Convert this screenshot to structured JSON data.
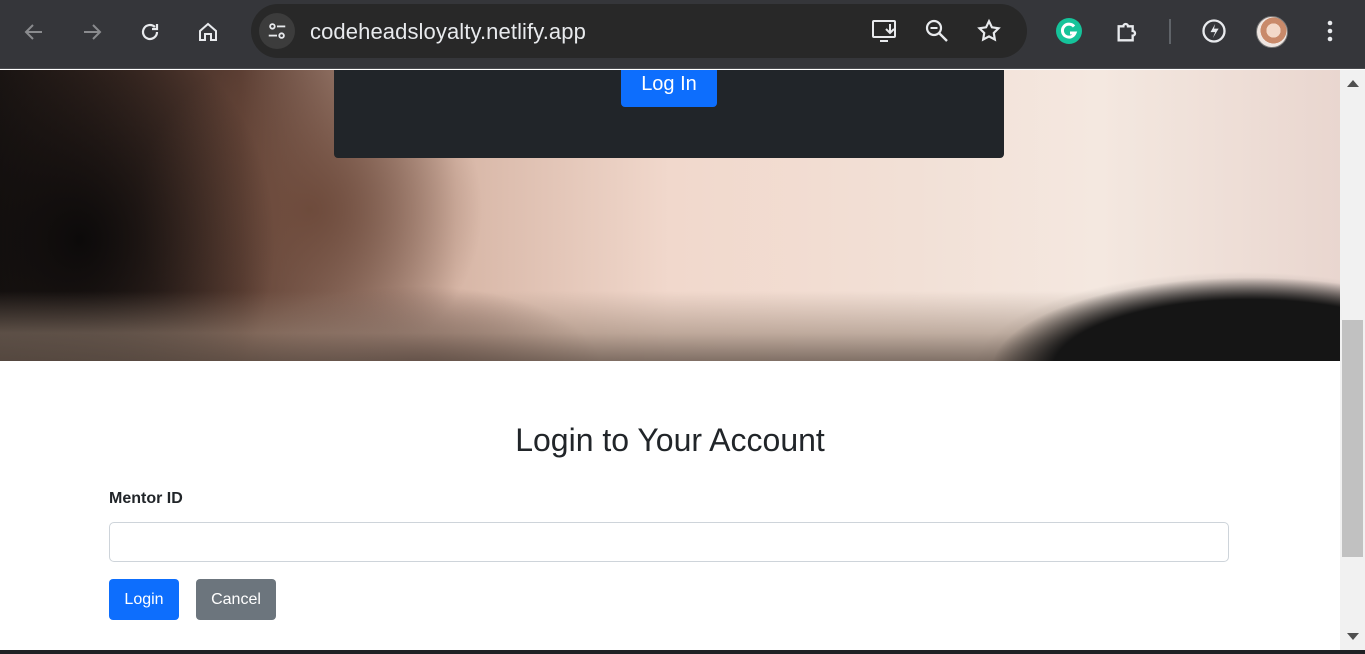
{
  "browser": {
    "url": "codeheadsloyalty.netlify.app"
  },
  "hero": {
    "card_login_label": "Log In"
  },
  "form": {
    "title": "Login to Your Account",
    "mentor_id_label": "Mentor ID",
    "mentor_id_value": "",
    "login_label": "Login",
    "cancel_label": "Cancel"
  },
  "colors": {
    "primary": "#0d6efd",
    "secondary": "#6c757d",
    "card_dark": "#212529",
    "chrome_bg": "#35363a"
  }
}
